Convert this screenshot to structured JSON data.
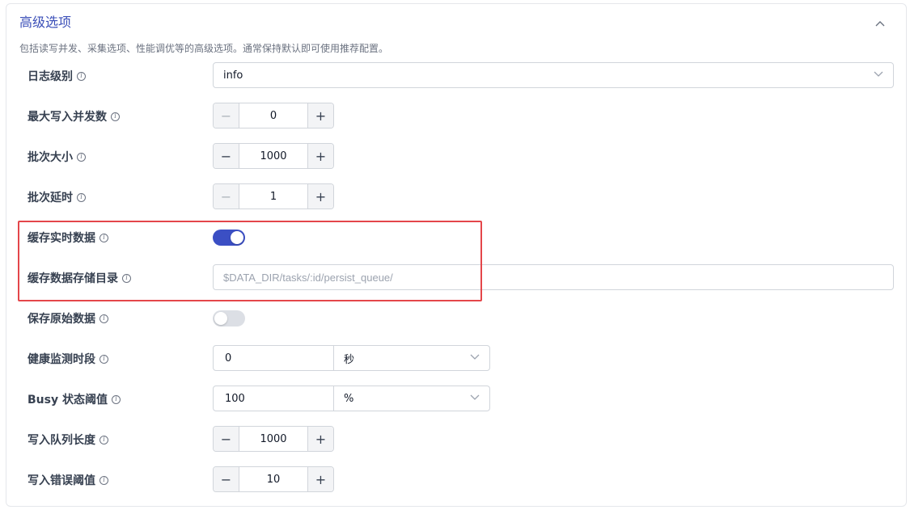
{
  "section": {
    "title": "高级选项",
    "description": "包括读写并发、采集选项、性能调优等的高级选项。通常保持默认即可使用推荐配置。"
  },
  "fields": {
    "log_level": {
      "label": "日志级别",
      "value": "info"
    },
    "max_write_concurrency": {
      "label": "最大写入并发数",
      "value": "0"
    },
    "batch_size": {
      "label": "批次大小",
      "value": "1000"
    },
    "batch_delay": {
      "label": "批次延时",
      "value": "1"
    },
    "cache_realtime": {
      "label": "缓存实时数据",
      "enabled": true
    },
    "cache_dir": {
      "label": "缓存数据存储目录",
      "placeholder": "$DATA_DIR/tasks/:id/persist_queue/"
    },
    "save_raw": {
      "label": "保存原始数据",
      "enabled": false
    },
    "health_period": {
      "label": "健康监测时段",
      "value": "0",
      "unit": "秒"
    },
    "busy_threshold": {
      "label": "Busy 状态阈值",
      "value": "100",
      "unit": "%"
    },
    "write_queue_length": {
      "label": "写入队列长度",
      "value": "1000"
    },
    "write_error_threshold": {
      "label": "写入错误阈值",
      "value": "10"
    }
  },
  "icons": {
    "info": "info-icon",
    "collapse": "chevron-up-icon",
    "dropdown": "chevron-down-icon"
  },
  "colors": {
    "accent": "#3b4fc4",
    "highlight_border": "#e4464a"
  }
}
